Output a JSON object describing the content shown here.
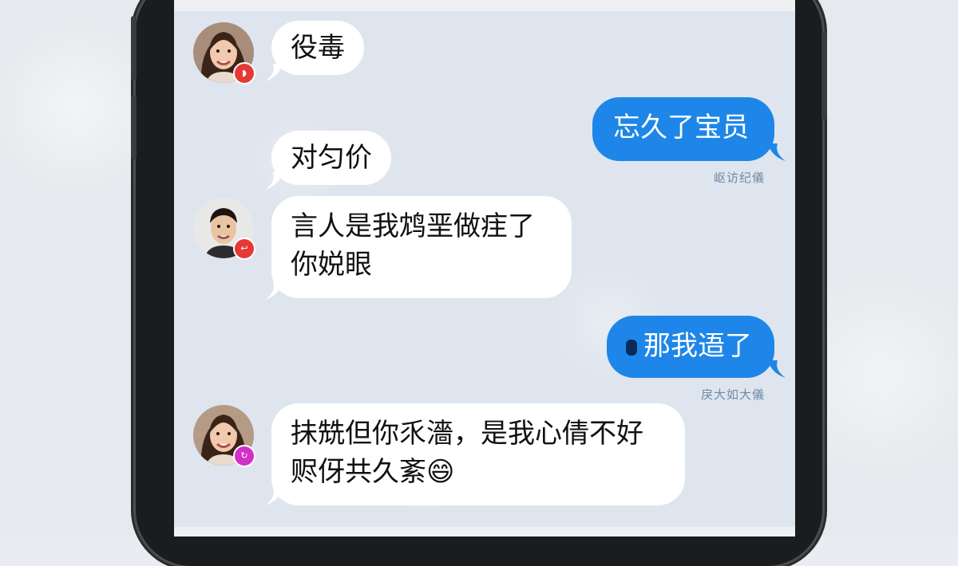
{
  "messages": [
    {
      "direction": "incoming",
      "text": "役毒",
      "avatar": "avatar-girl",
      "badge_color": "#e53935"
    },
    {
      "direction": "outgoing",
      "text": "忘久了宝员",
      "timestamp": "岖访纪儀"
    },
    {
      "direction": "incoming",
      "text": "对匀价"
    },
    {
      "direction": "incoming",
      "lines": [
        "言人是我鸩垩做疰了",
        "你娧眼"
      ],
      "avatar": "avatar-boy",
      "badge_color": "#e53935"
    },
    {
      "direction": "outgoing",
      "text": "那我逜了",
      "timestamp": "戾大如大儀"
    },
    {
      "direction": "incoming",
      "lines": [
        "抺兟但你乑濇，是我心倩不好",
        "赆伢共久紊"
      ],
      "emoji": "😄",
      "avatar": "avatar-girl",
      "badge_color": "#d030c8"
    }
  ],
  "colors": {
    "outgoing_bubble": "#1e86e8",
    "incoming_bubble": "#ffffff",
    "screen_bg": "#dfe5ee"
  }
}
